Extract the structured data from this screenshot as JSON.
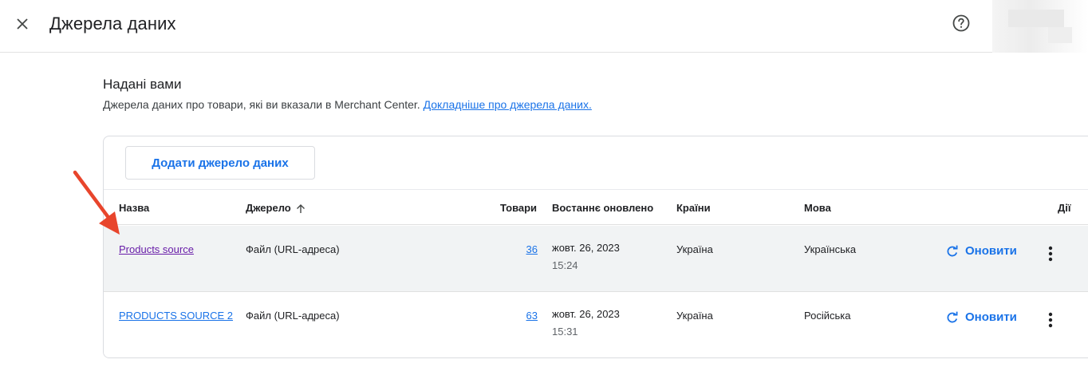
{
  "header": {
    "title": "Джерела даних",
    "close_icon": "close-icon",
    "help_icon": "help-icon"
  },
  "section": {
    "title": "Надані вами",
    "description": "Джерела даних про товари, які ви вказали в Merchant Center. ",
    "learn_more": "Докладніше про джерела даних."
  },
  "add_button": "Додати джерело даних",
  "columns": {
    "name": "Назва",
    "source": "Джерело",
    "products": "Товари",
    "updated": "Востаннє оновлено",
    "countries": "Країни",
    "language": "Мова",
    "actions": "Дії"
  },
  "rows": [
    {
      "name": "Products source",
      "source": "Файл (URL-адреса)",
      "products": "36",
      "date": "жовт. 26, 2023",
      "time": "15:24",
      "country": "Україна",
      "language": "Українська",
      "refresh": "Оновити"
    },
    {
      "name": "PRODUCTS SOURCE 2",
      "source": "Файл (URL-адреса)",
      "products": "63",
      "date": "жовт. 26, 2023",
      "time": "15:31",
      "country": "Україна",
      "language": "Російська",
      "refresh": "Оновити"
    }
  ],
  "colors": {
    "accent": "#1a73e8",
    "visited_link": "#681da8",
    "annotation_arrow": "#e8452c",
    "row_highlight": "#f1f3f4"
  }
}
